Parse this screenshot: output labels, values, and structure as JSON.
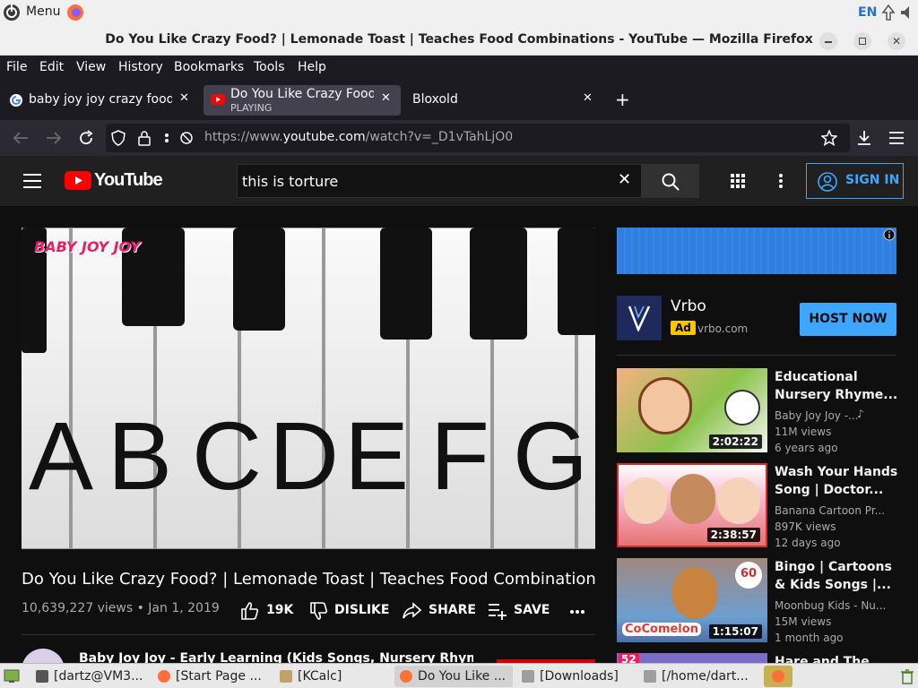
{
  "system": {
    "menu_label": "Menu",
    "lang": "EN"
  },
  "window": {
    "title": "Do You Like Crazy Food? | Lemonade Toast | Teaches Food Combinations - YouTube — Mozilla Firefox"
  },
  "menubar": {
    "items": [
      "File",
      "Edit",
      "View",
      "History",
      "Bookmarks",
      "Tools",
      "Help"
    ]
  },
  "tabs": [
    {
      "label": "baby joy joy crazy food - G"
    },
    {
      "label": "Do You Like Crazy Food?",
      "sub": "PLAYING"
    },
    {
      "label": "Bloxold"
    }
  ],
  "nav": {
    "url_prefix": "https://www.",
    "url_domain": "youtube.com",
    "url_path": "/watch?v=_D1vTahLjO0"
  },
  "youtube": {
    "logo_text": "YouTube",
    "search_value": "this is torture",
    "signin_label": "SIGN IN",
    "video": {
      "watermark": "BABY JOY JOY",
      "letters": [
        "A",
        "B",
        "C",
        "D",
        "E",
        "F",
        "G"
      ],
      "title": "Do You Like Crazy Food? | Lemonade Toast | Teaches Food Combinations",
      "stats": "10,639,227 views • Jan 1, 2019",
      "likes": "19K",
      "dislike": "DISLIKE",
      "share": "SHARE",
      "save": "SAVE"
    },
    "channel_line": "Baby Joy Joy - Early Learning (Kids Songs, Nursery Rhymes and Baby",
    "ad": {
      "name": "Vrbo",
      "badge": "Ad",
      "domain": "vrbo.com",
      "button": "HOST NOW"
    },
    "related": [
      {
        "title": "Educational Nursery Rhyme...",
        "channel": "Baby Joy Joy -...",
        "views": "11M views",
        "age": "6 years ago",
        "duration": "2:02:22",
        "thumb_color": "#4caf50"
      },
      {
        "title": "Wash Your Hands Song | Doctor...",
        "channel": "Banana Cartoon Pr...",
        "views": "897K views",
        "age": "12 days ago",
        "duration": "2:38:57",
        "thumb_color": "#e57373"
      },
      {
        "title": "Bingo | Cartoons & Kids Songs |...",
        "channel": "Moonbug Kids - Nu...",
        "views": "15M views",
        "age": "1 month ago",
        "duration": "1:15:07",
        "thumb_color": "#8d6e63",
        "badge": "60 min"
      },
      {
        "title": "Hare and The",
        "badge": "52"
      }
    ]
  },
  "taskbar": {
    "items": [
      "[dartz@VM3...",
      "[Start Page ...",
      "[KCalc]",
      "Do You Like ...",
      "[Downloads]",
      "[/home/dart..."
    ]
  },
  "colors": {
    "yt_red": "#ff0000",
    "link_blue": "#3ea6ff",
    "ad_blue": "#1a73e8",
    "firefox_dark": "#1c1b22"
  }
}
